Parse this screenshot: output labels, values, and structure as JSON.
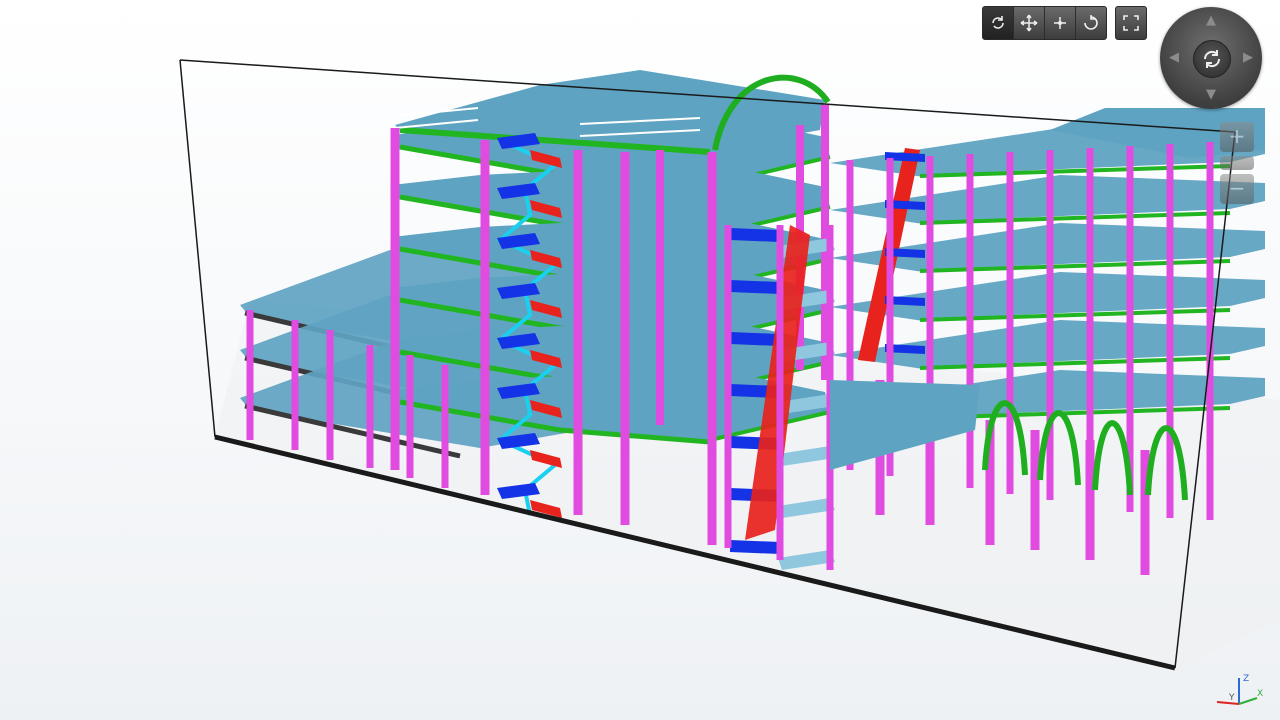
{
  "toolbar": {
    "buttons": [
      {
        "icon": "orbit-icon",
        "active": true
      },
      {
        "icon": "pan-icon",
        "active": false
      },
      {
        "icon": "walk-icon",
        "active": false
      },
      {
        "icon": "look-around-icon",
        "active": false
      }
    ],
    "fit_icon": "fit-to-view-icon"
  },
  "navigation": {
    "center_icon": "orbit-icon",
    "arrows": [
      "up",
      "down",
      "left",
      "right"
    ]
  },
  "zoom": {
    "in_label": "+",
    "out_label": "−"
  },
  "triad": {
    "x_label": "X",
    "y_label": "Y",
    "z_label": "Z"
  },
  "model": {
    "colors": {
      "slab": "#5fa3c2",
      "slab_edge": "#3f86a8",
      "column": "#e04be0",
      "beam": "#22b522",
      "stair_flight": "#e8221c",
      "landing": "#1432e6",
      "stair_stringer": "#19d0f0",
      "steel_beam": "#3a3a3a",
      "arch": "#1fae1f",
      "railing": "#ffffff",
      "frame": "#1a1a1a"
    }
  }
}
